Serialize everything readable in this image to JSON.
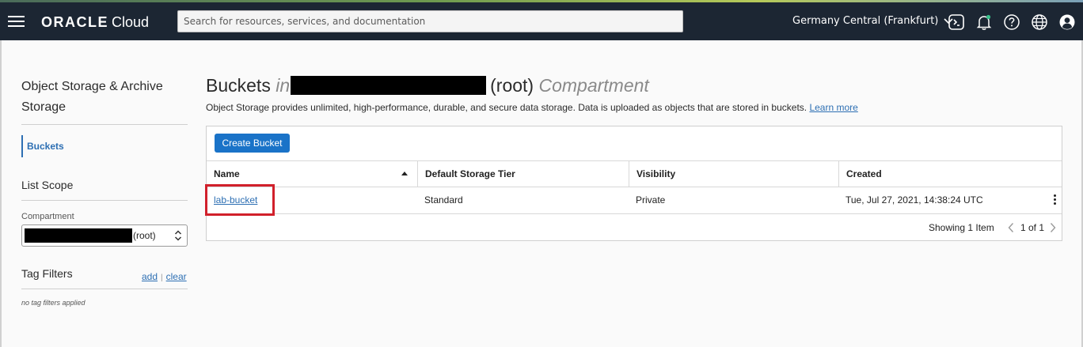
{
  "header": {
    "brand": "ORACLE",
    "product": "Cloud",
    "search_placeholder": "Search for resources, services, and documentation",
    "region": "Germany Central (Frankfurt)"
  },
  "sidebar": {
    "title": "Object Storage & Archive Storage",
    "nav_items": [
      {
        "label": "Buckets",
        "active": true
      }
    ],
    "list_scope_heading": "List Scope",
    "compartment_label": "Compartment",
    "compartment_value": "(root)",
    "tag_filters_heading": "Tag Filters",
    "tag_add": "add",
    "tag_separator": "|",
    "tag_clear": "clear",
    "no_tags_text": "no tag filters applied"
  },
  "main": {
    "title_prefix": "Buckets",
    "title_in": "in",
    "title_root": "(root)",
    "title_suffix": "Compartment",
    "description": "Object Storage provides unlimited, high-performance, durable, and secure data storage. Data is uploaded as objects that are stored in buckets.",
    "learn_more": "Learn more",
    "create_button": "Create Bucket",
    "table": {
      "columns": [
        "Name",
        "Default Storage Tier",
        "Visibility",
        "Created"
      ],
      "rows": [
        {
          "name": "lab-bucket",
          "tier": "Standard",
          "visibility": "Private",
          "created": "Tue, Jul 27, 2021, 14:38:24 UTC"
        }
      ]
    },
    "footer": {
      "showing": "Showing 1 Item",
      "page": "1 of 1"
    }
  },
  "colors": {
    "topbar": "#1c2633",
    "link": "#2d6fb3",
    "primary_button": "#1a73c8",
    "highlight": "#d1202b"
  }
}
